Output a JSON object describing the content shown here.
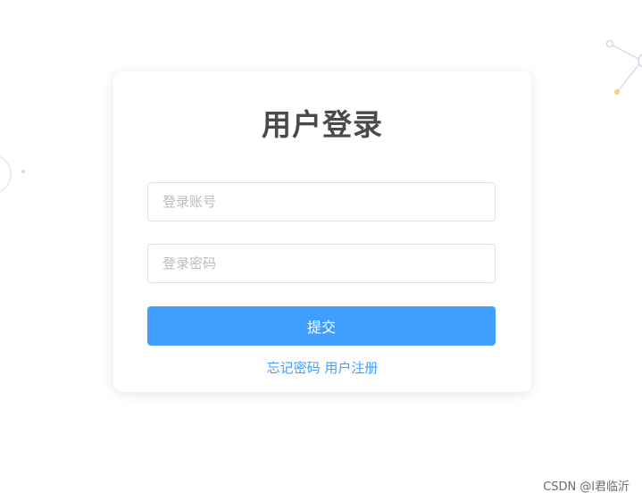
{
  "login": {
    "title": "用户登录",
    "account_placeholder": "登录账号",
    "password_placeholder": "登录密码",
    "submit_label": "提交",
    "forgot_password_label": "忘记密码",
    "register_label": "用户注册"
  },
  "watermark": "CSDN @l君临沂",
  "colors": {
    "primary": "#409eff",
    "title": "#4a4a4a",
    "placeholder": "#b9bcc2",
    "border": "#dcdfe6",
    "decor_line": "#c9d4ef",
    "decor_dot": "#f5cf86"
  }
}
